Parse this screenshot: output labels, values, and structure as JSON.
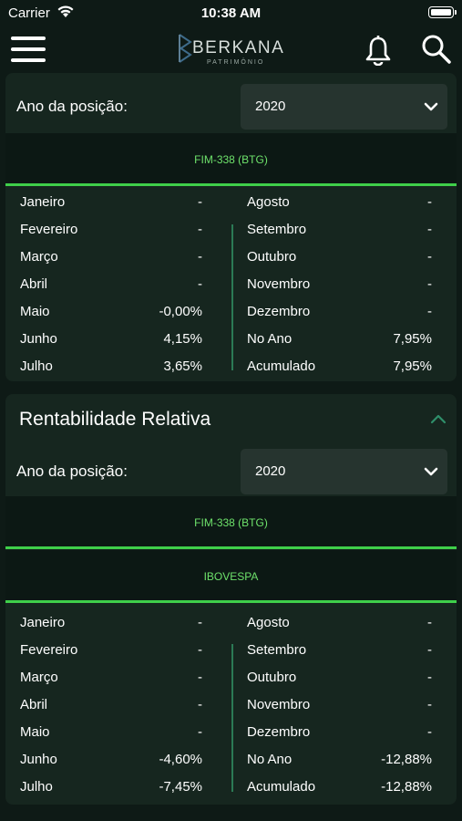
{
  "status": {
    "carrier": "Carrier",
    "time": "10:38 AM"
  },
  "header": {
    "brand": "BERKANA",
    "brand_sub": "PATRIMÔNIO"
  },
  "colors": {
    "accent": "#3fcf4a",
    "fund_label": "#6ee26b",
    "background": "#0e1a16",
    "card": "#16261f"
  },
  "section1": {
    "year_label": "Ano da posição:",
    "year_value": "2020",
    "fund": "FIM-338 (BTG)",
    "rows": [
      {
        "m1": "Janeiro",
        "v1": "-",
        "m2": "Agosto",
        "v2": "-"
      },
      {
        "m1": "Fevereiro",
        "v1": "-",
        "m2": "Setembro",
        "v2": "-"
      },
      {
        "m1": "Março",
        "v1": "-",
        "m2": "Outubro",
        "v2": "-"
      },
      {
        "m1": "Abril",
        "v1": "-",
        "m2": "Novembro",
        "v2": "-"
      },
      {
        "m1": "Maio",
        "v1": "-0,00%",
        "m2": "Dezembro",
        "v2": "-"
      },
      {
        "m1": "Junho",
        "v1": "4,15%",
        "m2": "No Ano",
        "v2": "7,95%"
      },
      {
        "m1": "Julho",
        "v1": "3,65%",
        "m2": "Acumulado",
        "v2": "7,95%"
      }
    ]
  },
  "section2": {
    "title": "Rentabilidade Relativa",
    "year_label": "Ano da posição:",
    "year_value": "2020",
    "fund": "FIM-338 (BTG)",
    "benchmark": "IBOVESPA",
    "rows": [
      {
        "m1": "Janeiro",
        "v1": "-",
        "m2": "Agosto",
        "v2": "-"
      },
      {
        "m1": "Fevereiro",
        "v1": "-",
        "m2": "Setembro",
        "v2": "-"
      },
      {
        "m1": "Março",
        "v1": "-",
        "m2": "Outubro",
        "v2": "-"
      },
      {
        "m1": "Abril",
        "v1": "-",
        "m2": "Novembro",
        "v2": "-"
      },
      {
        "m1": "Maio",
        "v1": "-",
        "m2": "Dezembro",
        "v2": "-"
      },
      {
        "m1": "Junho",
        "v1": "-4,60%",
        "m2": "No Ano",
        "v2": "-12,88%"
      },
      {
        "m1": "Julho",
        "v1": "-7,45%",
        "m2": "Acumulado",
        "v2": "-12,88%"
      }
    ]
  }
}
